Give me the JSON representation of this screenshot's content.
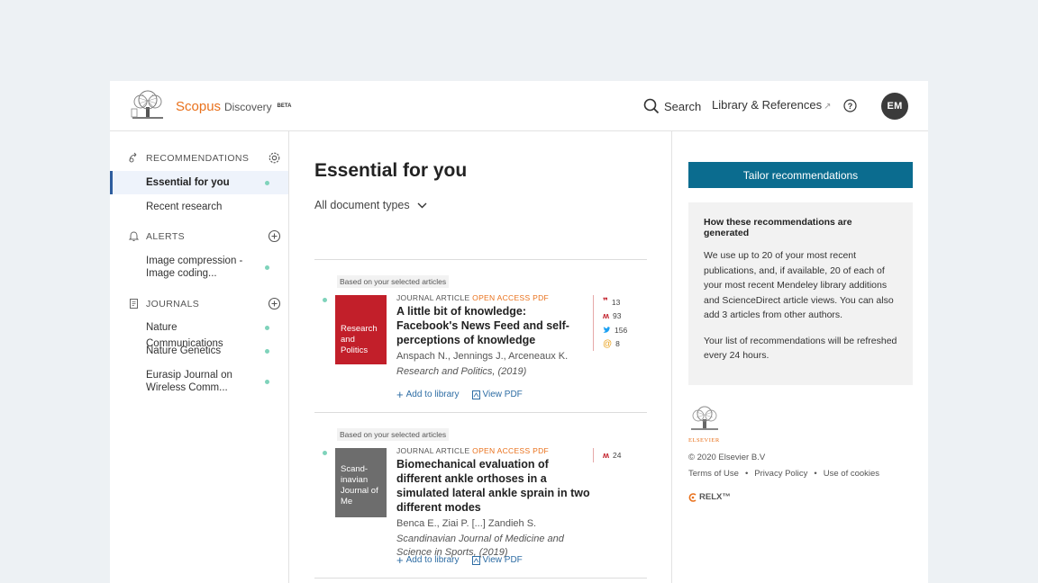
{
  "header": {
    "brand_scopus": "Scopus",
    "brand_discovery": "Discovery",
    "brand_beta": "BETA",
    "search_label": "Search",
    "library_label": "Library & References",
    "avatar_initials": "EM"
  },
  "sidebar": {
    "recommendations_heading": "RECOMMENDATIONS",
    "rec_items": [
      {
        "label": "Essential for you",
        "active": true
      },
      {
        "label": "Recent research",
        "active": false
      }
    ],
    "alerts_heading": "ALERTS",
    "alert_items": [
      {
        "label": "Image compression - Image coding..."
      }
    ],
    "journals_heading": "JOURNALS",
    "journal_items": [
      {
        "label": "Nature Communications"
      },
      {
        "label": "Nature Genetics"
      },
      {
        "label": "Eurasip Journal on Wireless Comm..."
      }
    ]
  },
  "main": {
    "title": "Essential for you",
    "doc_type_filter": "All document types",
    "articles": [
      {
        "basis": "Based on your selected articles",
        "cover_text": "Research and Politics",
        "type": "JOURNAL ARTICLE",
        "open_access": "OPEN ACCESS",
        "pdf": "PDF",
        "title": "A little bit of knowledge: Facebook's News Feed and self-perceptions of knowledge",
        "authors": "Anspach N., Jennings J., Arceneaux K.",
        "journal": "Research and Politics, (2019)",
        "metrics": {
          "citations": "13",
          "mendeley": "93",
          "twitter": "156",
          "mentions": "8"
        },
        "add_label": "Add to library",
        "view_label": "View PDF"
      },
      {
        "basis": "Based on your selected articles",
        "cover_text": "Scand-inavian Journal of Me",
        "type": "JOURNAL ARTICLE",
        "open_access": "OPEN ACCESS",
        "pdf": "PDF",
        "title": "Biomechanical evaluation of different ankle orthoses in a simulated lateral ankle sprain in two different modes",
        "authors": "Benca E., Ziai P. [...] Zandieh S.",
        "journal": "Scandinavian Journal of Medicine and Science in Sports, (2019)",
        "metrics": {
          "mendeley": "24"
        },
        "add_label": "Add to library",
        "view_label": "View PDF"
      }
    ]
  },
  "right": {
    "tailor_button": "Tailor recommendations",
    "info_title": "How these recommendations are generated",
    "info_p1": "We use up to 20 of your most recent publications, and, if available, 20 of each of your most recent Mendeley library additions and ScienceDirect article views. You can also add 3 articles from other authors.",
    "info_p2": "Your list of recommendations will be refreshed every 24 hours.",
    "elsevier_label": "ELSEVIER",
    "copyright": "© 2020 Elsevier B.V",
    "footer_links": [
      "Terms of Use",
      "•",
      "Privacy Policy",
      "•",
      "Use of cookies"
    ],
    "relx": "RELX™"
  },
  "colors": {
    "scopus_orange": "#e9711c",
    "accent_teal": "#0b6c8f",
    "active_border": "#2e5d9e",
    "status_dot": "#7fd3bb",
    "cover_red": "#c21f2a"
  }
}
